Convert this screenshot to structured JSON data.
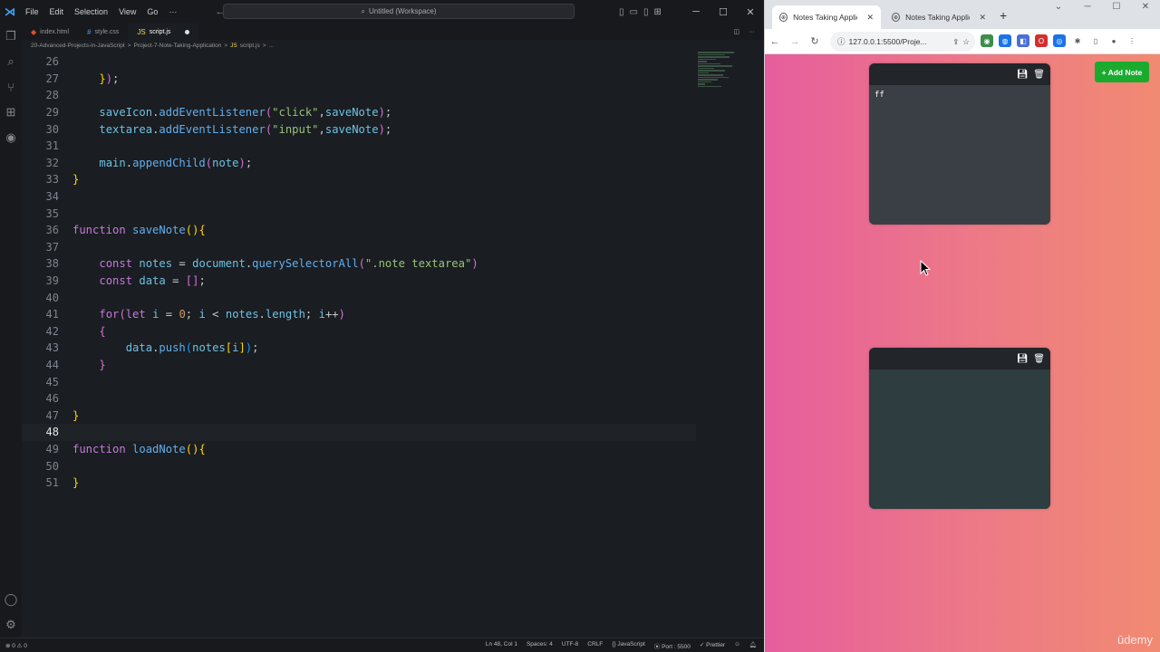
{
  "vscode": {
    "menu": [
      "File",
      "Edit",
      "Selection",
      "View",
      "Go"
    ],
    "command_center": "Untitled (Workspace)",
    "tabs": [
      {
        "label": "index.html",
        "color": "#e44d26"
      },
      {
        "label": "style.css",
        "color": "#42a5f5"
      },
      {
        "label": "script.js",
        "color": "#f0db4f"
      }
    ],
    "breadcrumb": [
      "20-Advanced-Projects-in-JavaScript",
      ">",
      "Project-7-Note-Taking-Application",
      ">",
      "script.js",
      ">",
      "..."
    ],
    "code_lines": [
      {
        "n": "26",
        "html": ""
      },
      {
        "n": "27",
        "html": "    <span class='b1'>}</span><span class='b2'>)</span><span class='p'>;</span>"
      },
      {
        "n": "28",
        "html": ""
      },
      {
        "n": "29",
        "html": "    <span class='v'>saveIcon</span><span class='p'>.</span><span class='f'>addEventListener</span><span class='b2'>(</span><span class='s'>\"click\"</span><span class='p'>,</span><span class='v'>saveNote</span><span class='b2'>)</span><span class='p'>;</span>"
      },
      {
        "n": "30",
        "html": "    <span class='v'>textarea</span><span class='p'>.</span><span class='f'>addEventListener</span><span class='b2'>(</span><span class='s'>\"input\"</span><span class='p'>,</span><span class='v'>saveNote</span><span class='b2'>)</span><span class='p'>;</span>"
      },
      {
        "n": "31",
        "html": ""
      },
      {
        "n": "32",
        "html": "    <span class='v'>main</span><span class='p'>.</span><span class='f'>appendChild</span><span class='b2'>(</span><span class='v'>note</span><span class='b2'>)</span><span class='p'>;</span>"
      },
      {
        "n": "33",
        "html": "<span class='b1'>}</span>"
      },
      {
        "n": "34",
        "html": ""
      },
      {
        "n": "35",
        "html": ""
      },
      {
        "n": "36",
        "html": "<span class='k'>function</span> <span class='f'>saveNote</span><span class='b1'>()</span><span class='b1'>{</span>"
      },
      {
        "n": "37",
        "html": ""
      },
      {
        "n": "38",
        "html": "    <span class='k'>const</span> <span class='v'>notes</span> <span class='p'>=</span> <span class='v'>document</span><span class='p'>.</span><span class='f'>querySelectorAll</span><span class='b2'>(</span><span class='s'>\".note textarea\"</span><span class='b2'>)</span>"
      },
      {
        "n": "39",
        "html": "    <span class='k'>const</span> <span class='v'>data</span> <span class='p'>=</span> <span class='b2'>[]</span><span class='p'>;</span>"
      },
      {
        "n": "40",
        "html": ""
      },
      {
        "n": "41",
        "html": "    <span class='k'>for</span><span class='b2'>(</span><span class='k'>let</span> <span class='v'>i</span> <span class='p'>=</span> <span class='n'>0</span><span class='p'>;</span> <span class='v'>i</span> <span class='p'>&lt;</span> <span class='v'>notes</span><span class='p'>.</span><span class='v'>length</span><span class='p'>;</span> <span class='v'>i</span><span class='p'>++</span><span class='b2'>)</span>"
      },
      {
        "n": "42",
        "html": "    <span class='b2'>{</span>"
      },
      {
        "n": "43",
        "html": "        <span class='v'>data</span><span class='p'>.</span><span class='f'>push</span><span class='b3'>(</span><span class='v'>notes</span><span class='b1'>[</span><span class='v'>i</span><span class='b1'>]</span><span class='b3'>)</span><span class='p'>;</span>"
      },
      {
        "n": "44",
        "html": "    <span class='b2'>}</span>"
      },
      {
        "n": "45",
        "html": ""
      },
      {
        "n": "46",
        "html": ""
      },
      {
        "n": "47",
        "html": "<span class='b1'>}</span>"
      },
      {
        "n": "48",
        "html": "",
        "current": true
      },
      {
        "n": "49",
        "html": "<span class='k'>function</span> <span class='f'>loadNote</span><span class='b1'>()</span><span class='b1'>{</span>"
      },
      {
        "n": "50",
        "html": ""
      },
      {
        "n": "51",
        "html": "<span class='b1'>}</span>"
      }
    ],
    "status_left": "⊗ 0 ⚠ 0",
    "status_right": [
      "Ln 48, Col 1",
      "Spaces: 4",
      "UTF-8",
      "CRLF",
      "{} JavaScript",
      "⦿ Port : 5500",
      "✓ Prettier"
    ]
  },
  "browser": {
    "tabs": [
      {
        "label": "Notes Taking Applicati"
      },
      {
        "label": "Notes Taking Applicati"
      }
    ],
    "url": "127.0.0.1:5500/Proje...",
    "add_note_label": "Add Note",
    "notes": [
      {
        "text": "ff"
      },
      {
        "text": ""
      }
    ],
    "watermark": "ūdemy"
  }
}
